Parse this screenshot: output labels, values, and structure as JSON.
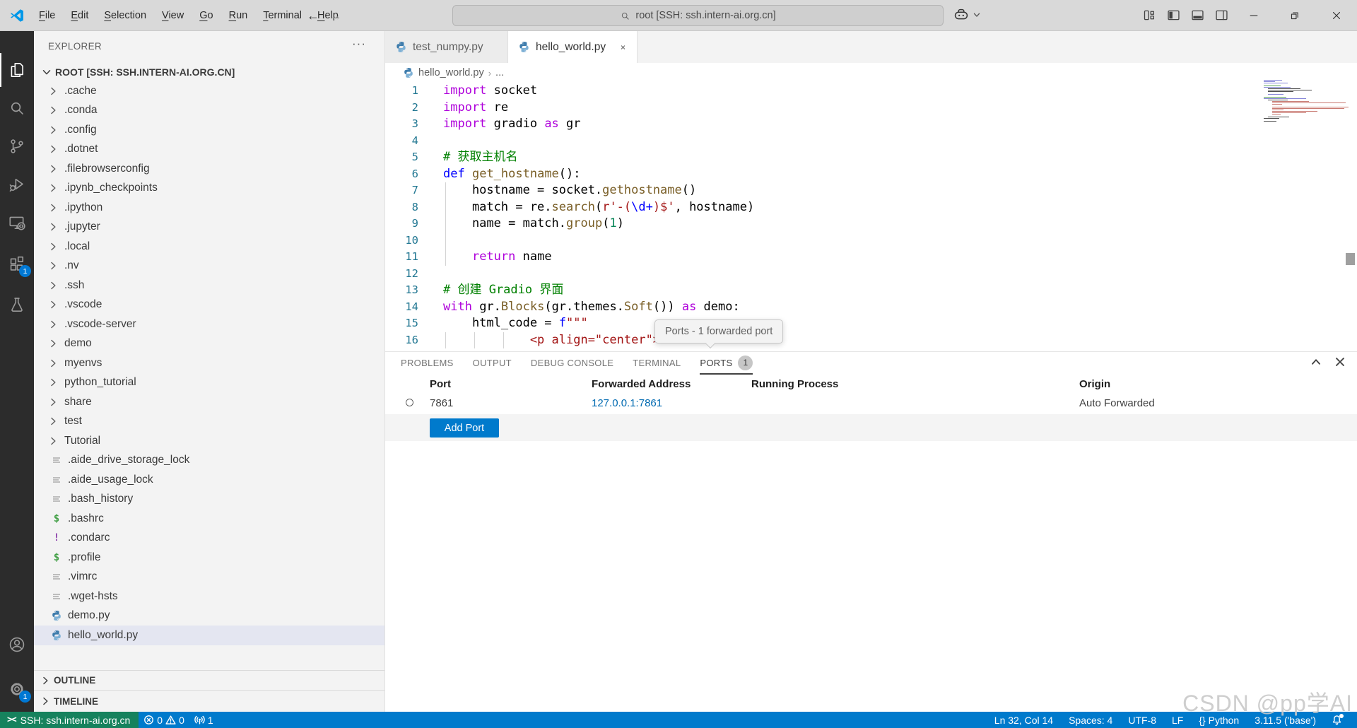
{
  "window": {
    "menu": [
      "File",
      "Edit",
      "Selection",
      "View",
      "Go",
      "Run",
      "Terminal",
      "Help"
    ],
    "command_center": "root [SSH: ssh.intern-ai.org.cn]",
    "back": "←",
    "forward": "→"
  },
  "activity_bar": {
    "top": [
      {
        "id": "explorer",
        "icon": "files",
        "active": true
      },
      {
        "id": "search",
        "icon": "search"
      },
      {
        "id": "source-control",
        "icon": "git"
      },
      {
        "id": "run-debug",
        "icon": "debug"
      },
      {
        "id": "remote-explorer",
        "icon": "remote"
      },
      {
        "id": "extensions",
        "icon": "extensions",
        "badge": "1"
      },
      {
        "id": "testing",
        "icon": "beaker"
      }
    ],
    "bottom": [
      {
        "id": "accounts",
        "icon": "account"
      },
      {
        "id": "settings",
        "icon": "gear",
        "badge": "1"
      }
    ]
  },
  "explorer": {
    "title": "EXPLORER",
    "actions": "···",
    "root_label": "ROOT [SSH: SSH.INTERN-AI.ORG.CN]",
    "items": [
      {
        "label": ".cache",
        "kind": "folder"
      },
      {
        "label": ".conda",
        "kind": "folder"
      },
      {
        "label": ".config",
        "kind": "folder"
      },
      {
        "label": ".dotnet",
        "kind": "folder"
      },
      {
        "label": ".filebrowserconfig",
        "kind": "folder"
      },
      {
        "label": ".ipynb_checkpoints",
        "kind": "folder"
      },
      {
        "label": ".ipython",
        "kind": "folder"
      },
      {
        "label": ".jupyter",
        "kind": "folder"
      },
      {
        "label": ".local",
        "kind": "folder"
      },
      {
        "label": ".nv",
        "kind": "folder"
      },
      {
        "label": ".ssh",
        "kind": "folder"
      },
      {
        "label": ".vscode",
        "kind": "folder"
      },
      {
        "label": ".vscode-server",
        "kind": "folder"
      },
      {
        "label": "demo",
        "kind": "folder"
      },
      {
        "label": "myenvs",
        "kind": "folder"
      },
      {
        "label": "python_tutorial",
        "kind": "folder"
      },
      {
        "label": "share",
        "kind": "folder"
      },
      {
        "label": "test",
        "kind": "folder"
      },
      {
        "label": "Tutorial",
        "kind": "folder"
      },
      {
        "label": ".aide_drive_storage_lock",
        "kind": "lines"
      },
      {
        "label": ".aide_usage_lock",
        "kind": "lines"
      },
      {
        "label": ".bash_history",
        "kind": "lines"
      },
      {
        "label": ".bashrc",
        "kind": "shell"
      },
      {
        "label": ".condarc",
        "kind": "bang"
      },
      {
        "label": ".profile",
        "kind": "shell"
      },
      {
        "label": ".vimrc",
        "kind": "lines"
      },
      {
        "label": ".wget-hsts",
        "kind": "lines"
      },
      {
        "label": "demo.py",
        "kind": "python"
      },
      {
        "label": "hello_world.py",
        "kind": "python",
        "selected": true
      }
    ],
    "sections": [
      "OUTLINE",
      "TIMELINE"
    ]
  },
  "editor": {
    "tabs": [
      {
        "label": "test_numpy.py",
        "active": false
      },
      {
        "label": "hello_world.py",
        "active": true
      }
    ],
    "breadcrumb": {
      "file": "hello_world.py",
      "sep": "›",
      "more": "..."
    },
    "code": [
      {
        "n": "1",
        "segs": [
          [
            "k",
            "import"
          ],
          [
            "p",
            " socket"
          ]
        ]
      },
      {
        "n": "2",
        "segs": [
          [
            "k",
            "import"
          ],
          [
            "p",
            " re"
          ]
        ]
      },
      {
        "n": "3",
        "segs": [
          [
            "k",
            "import"
          ],
          [
            "p",
            " gradio "
          ],
          [
            "k",
            "as"
          ],
          [
            "p",
            " gr"
          ]
        ]
      },
      {
        "n": "4",
        "segs": []
      },
      {
        "n": "5",
        "segs": [
          [
            "c",
            "# 获取主机名"
          ]
        ]
      },
      {
        "n": "6",
        "segs": [
          [
            "b",
            "def"
          ],
          [
            "p",
            " "
          ],
          [
            "f",
            "get_hostname"
          ],
          [
            "p",
            "():"
          ]
        ]
      },
      {
        "n": "7",
        "segs": [
          [
            "p",
            "    hostname = socket."
          ],
          [
            "f",
            "gethostname"
          ],
          [
            "p",
            "()"
          ]
        ],
        "g": [
          0
        ]
      },
      {
        "n": "8",
        "segs": [
          [
            "p",
            "    match = re."
          ],
          [
            "f",
            "search"
          ],
          [
            "p",
            "("
          ],
          [
            "s",
            "r'-("
          ],
          [
            "b",
            "\\d+"
          ],
          [
            "s",
            ")$'"
          ],
          [
            "p",
            ", hostname)"
          ]
        ],
        "g": [
          0
        ]
      },
      {
        "n": "9",
        "segs": [
          [
            "p",
            "    name = match."
          ],
          [
            "f",
            "group"
          ],
          [
            "p",
            "("
          ],
          [
            "n",
            "1"
          ],
          [
            "p",
            ")"
          ]
        ],
        "g": [
          0
        ]
      },
      {
        "n": "10",
        "segs": [],
        "g": [
          0
        ]
      },
      {
        "n": "11",
        "segs": [
          [
            "p",
            "    "
          ],
          [
            "k",
            "return"
          ],
          [
            "p",
            " name"
          ]
        ],
        "g": [
          0
        ]
      },
      {
        "n": "12",
        "segs": []
      },
      {
        "n": "13",
        "segs": [
          [
            "c",
            "# 创建 Gradio 界面"
          ]
        ]
      },
      {
        "n": "14",
        "segs": [
          [
            "k",
            "with"
          ],
          [
            "p",
            " gr."
          ],
          [
            "f",
            "Blocks"
          ],
          [
            "p",
            "(gr.themes."
          ],
          [
            "f",
            "Soft"
          ],
          [
            "p",
            "()) "
          ],
          [
            "k",
            "as"
          ],
          [
            "p",
            " demo:"
          ]
        ]
      },
      {
        "n": "15",
        "segs": [
          [
            "p",
            "    html_code = "
          ],
          [
            "b",
            "f"
          ],
          [
            "s",
            "\"\"\""
          ]
        ]
      },
      {
        "n": "16",
        "segs": [
          [
            "s",
            "            <p align=\"center\">"
          ]
        ],
        "g": [
          0,
          1,
          2
        ]
      }
    ],
    "minimap": [
      [
        0,
        26,
        "b"
      ],
      [
        0,
        16,
        "b"
      ],
      [
        0,
        34,
        "b"
      ],
      [
        0,
        0,
        ""
      ],
      [
        0,
        24,
        "g"
      ],
      [
        0,
        38,
        "b"
      ],
      [
        1,
        46,
        "k"
      ],
      [
        1,
        62,
        "k"
      ],
      [
        1,
        36,
        "k"
      ],
      [
        0,
        0,
        ""
      ],
      [
        1,
        22,
        "b"
      ],
      [
        0,
        0,
        ""
      ],
      [
        0,
        32,
        "g"
      ],
      [
        0,
        60,
        "b"
      ],
      [
        1,
        28,
        "k"
      ],
      [
        2,
        52,
        "r"
      ],
      [
        2,
        104,
        "r"
      ],
      [
        2,
        14,
        "r"
      ],
      [
        0,
        0,
        ""
      ],
      [
        2,
        108,
        "r"
      ],
      [
        2,
        102,
        "r"
      ],
      [
        2,
        16,
        "r"
      ],
      [
        2,
        64,
        "r"
      ],
      [
        2,
        48,
        "r"
      ],
      [
        2,
        12,
        "r"
      ],
      [
        0,
        0,
        ""
      ],
      [
        1,
        30,
        "k"
      ],
      [
        0,
        22,
        "k"
      ],
      [
        0,
        0,
        ""
      ],
      [
        0,
        18,
        "k"
      ]
    ]
  },
  "tooltip": "Ports - 1 forwarded port",
  "panel": {
    "tabs": [
      "PROBLEMS",
      "OUTPUT",
      "DEBUG CONSOLE",
      "TERMINAL",
      "PORTS"
    ],
    "active_tab": "PORTS",
    "badge": "1",
    "ports": {
      "columns": [
        "Port",
        "Forwarded Address",
        "Running Process",
        "Origin"
      ],
      "rows": [
        {
          "port": "7861",
          "address": "127.0.0.1:7861",
          "process": "",
          "origin": "Auto Forwarded"
        }
      ],
      "add_button": "Add Port"
    }
  },
  "status_bar": {
    "remote": "SSH: ssh.intern-ai.org.cn",
    "errors": "0",
    "warnings": "0",
    "ports_count": "1",
    "right": [
      "Ln 32, Col 14",
      "Spaces: 4",
      "UTF-8",
      "LF",
      "{} Python",
      "3.11.5 ('base')"
    ]
  },
  "watermark": "CSDN @pp学AI",
  "colors": {
    "statusbar": "#007acc",
    "remote_chip": "#16825d",
    "badge": "#0078d4",
    "button": "#007acc",
    "link": "#006ab1",
    "selection": "#e4e6f1"
  }
}
